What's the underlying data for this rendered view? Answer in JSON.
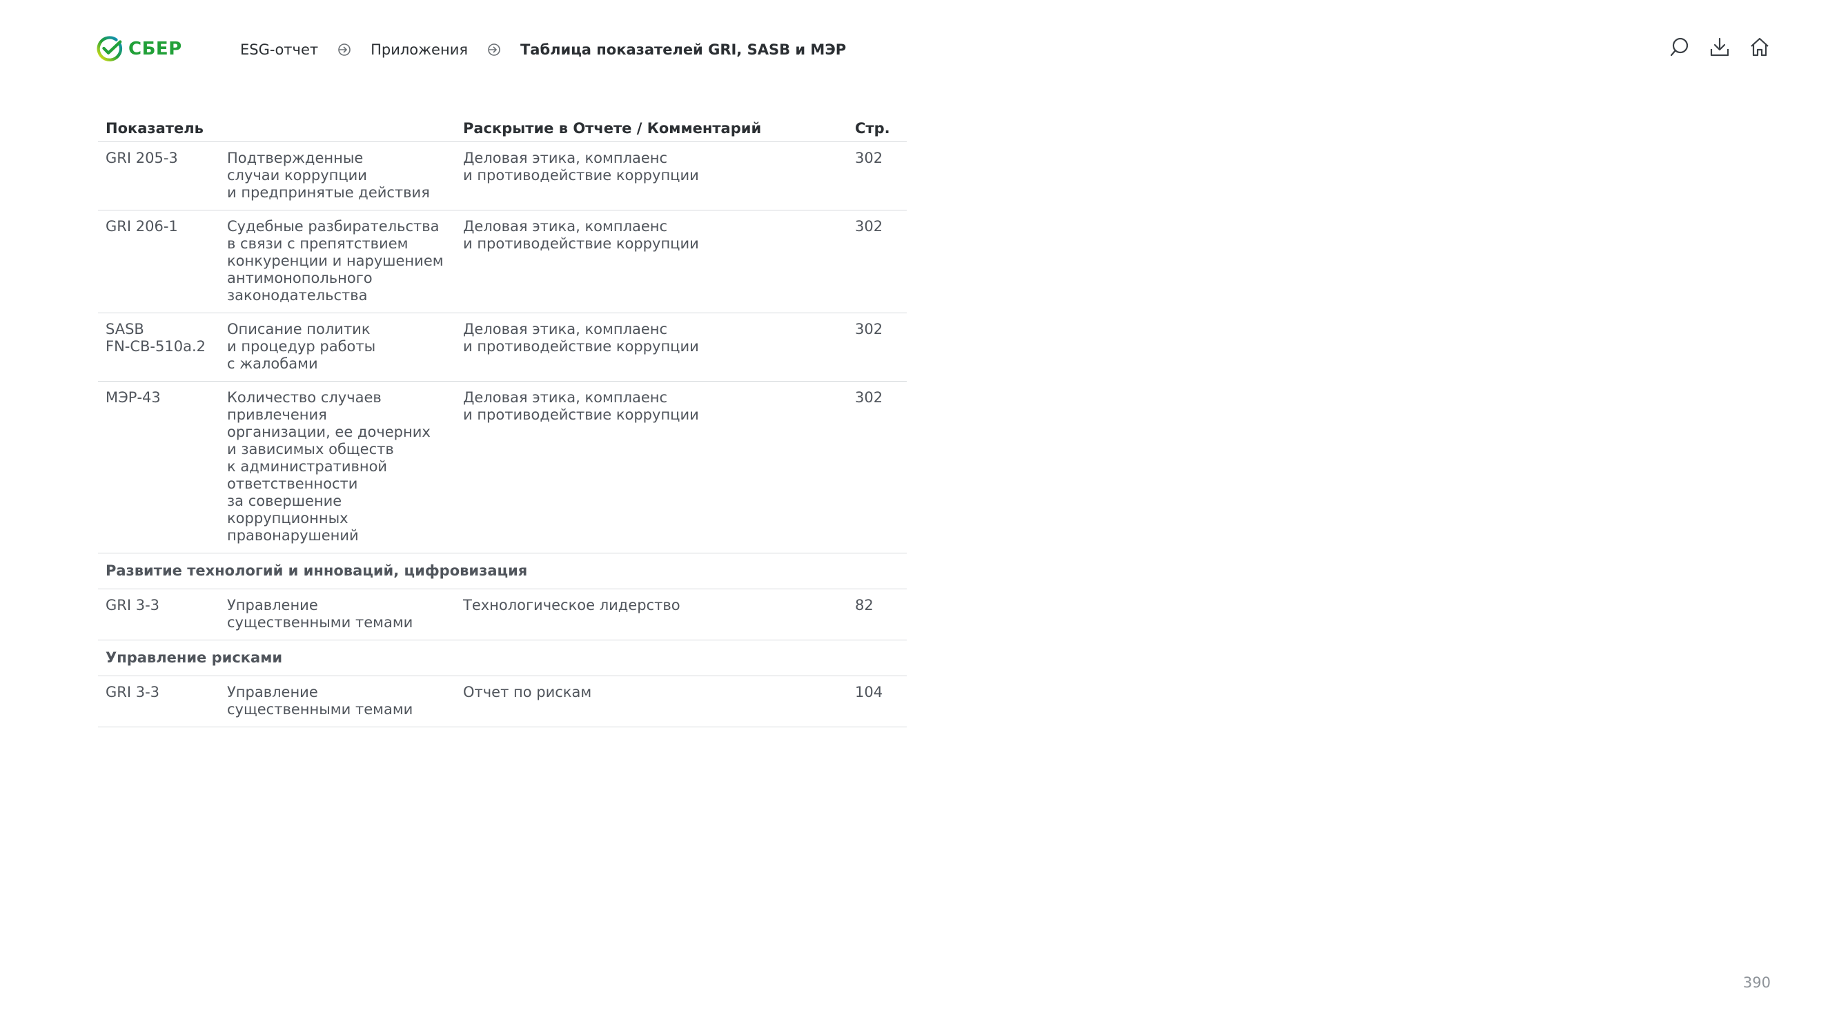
{
  "brand": {
    "name": "СБЕР",
    "color": "#21a038"
  },
  "breadcrumb": {
    "items": [
      "ESG-отчет",
      "Приложения"
    ],
    "current": "Таблица показателей GRI, SASB и МЭР"
  },
  "icons": [
    "search-icon",
    "download-icon",
    "home-icon"
  ],
  "table": {
    "headers": {
      "indicator": "Показатель",
      "disclosure": "Раскрытие в Отчете / Комментарий",
      "page": "Стр."
    },
    "rows": [
      {
        "code": "GRI 205-3",
        "name": "Подтвержденные\nслучаи коррупции\nи предпринятые действия",
        "disclosure": "Деловая этика, комплаенс\nи противодействие коррупции",
        "page": "302"
      },
      {
        "code": "GRI 206-1",
        "name": "Судебные разбирательства\nв связи с препятствием\nконкуренции и нарушением\nантимонопольного\nзаконодательства",
        "disclosure": "Деловая этика, комплаенс\nи противодействие коррупции",
        "page": "302"
      },
      {
        "code": "SASB\nFN-CB-510a.2",
        "name": "Описание политик\nи процедур работы\nс жалобами",
        "disclosure": "Деловая этика, комплаенс\nи противодействие коррупции",
        "page": "302"
      },
      {
        "code": "МЭР-43",
        "name": "Количество случаев\nпривлечения\nорганизации, ее дочерних\nи зависимых обществ\nк административной\nответственности\nза совершение\nкоррупционных\nправонарушений",
        "disclosure": "Деловая этика, комплаенс\nи противодействие коррупции",
        "page": "302"
      }
    ],
    "section_tech": "Развитие технологий и инноваций, цифровизация",
    "tech_row": {
      "code": "GRI 3-3",
      "name": "Управление\nсущественными темами",
      "disclosure": "Технологическое лидерство",
      "page": "82"
    },
    "section_risk": "Управление рисками",
    "risk_row": {
      "code": "GRI 3-3",
      "name": "Управление\nсущественными темами",
      "disclosure": "Отчет по рискам",
      "page": "104"
    }
  },
  "page_number": "390"
}
